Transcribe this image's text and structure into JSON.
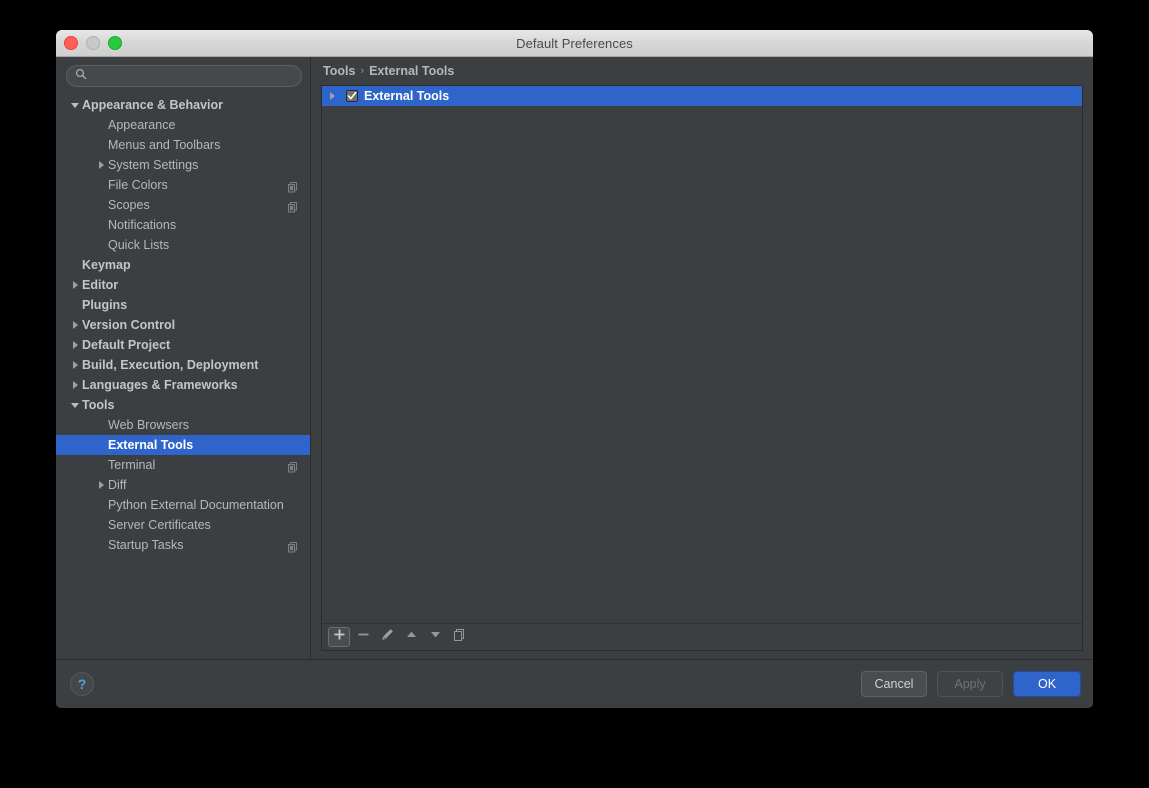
{
  "window": {
    "title": "Default Preferences",
    "traffic_lights": [
      "close-light",
      "minimize-light",
      "maximize-light"
    ]
  },
  "sidebar": {
    "search": {
      "value": "",
      "placeholder": "",
      "icon": "search-icon"
    },
    "items": [
      {
        "label": "Appearance & Behavior",
        "indent": 0,
        "arrow": "down",
        "bold": true,
        "selected": false,
        "badge": false
      },
      {
        "label": "Appearance",
        "indent": 1,
        "arrow": "none",
        "bold": false,
        "selected": false,
        "badge": false
      },
      {
        "label": "Menus and Toolbars",
        "indent": 1,
        "arrow": "none",
        "bold": false,
        "selected": false,
        "badge": false
      },
      {
        "label": "System Settings",
        "indent": 1,
        "arrow": "right",
        "bold": false,
        "selected": false,
        "badge": false
      },
      {
        "label": "File Colors",
        "indent": 1,
        "arrow": "none",
        "bold": false,
        "selected": false,
        "badge": true
      },
      {
        "label": "Scopes",
        "indent": 1,
        "arrow": "none",
        "bold": false,
        "selected": false,
        "badge": true
      },
      {
        "label": "Notifications",
        "indent": 1,
        "arrow": "none",
        "bold": false,
        "selected": false,
        "badge": false
      },
      {
        "label": "Quick Lists",
        "indent": 1,
        "arrow": "none",
        "bold": false,
        "selected": false,
        "badge": false
      },
      {
        "label": "Keymap",
        "indent": 0,
        "arrow": "none",
        "bold": true,
        "selected": false,
        "badge": false
      },
      {
        "label": "Editor",
        "indent": 0,
        "arrow": "right",
        "bold": true,
        "selected": false,
        "badge": false
      },
      {
        "label": "Plugins",
        "indent": 0,
        "arrow": "none",
        "bold": true,
        "selected": false,
        "badge": false
      },
      {
        "label": "Version Control",
        "indent": 0,
        "arrow": "right",
        "bold": true,
        "selected": false,
        "badge": false
      },
      {
        "label": "Default Project",
        "indent": 0,
        "arrow": "right",
        "bold": true,
        "selected": false,
        "badge": false
      },
      {
        "label": "Build, Execution, Deployment",
        "indent": 0,
        "arrow": "right",
        "bold": true,
        "selected": false,
        "badge": false
      },
      {
        "label": "Languages & Frameworks",
        "indent": 0,
        "arrow": "right",
        "bold": true,
        "selected": false,
        "badge": false
      },
      {
        "label": "Tools",
        "indent": 0,
        "arrow": "down",
        "bold": true,
        "selected": false,
        "badge": false
      },
      {
        "label": "Web Browsers",
        "indent": 1,
        "arrow": "none",
        "bold": false,
        "selected": false,
        "badge": false
      },
      {
        "label": "External Tools",
        "indent": 1,
        "arrow": "none",
        "bold": false,
        "selected": true,
        "badge": false
      },
      {
        "label": "Terminal",
        "indent": 1,
        "arrow": "none",
        "bold": false,
        "selected": false,
        "badge": true
      },
      {
        "label": "Diff",
        "indent": 1,
        "arrow": "right",
        "bold": false,
        "selected": false,
        "badge": false
      },
      {
        "label": "Python External Documentation",
        "indent": 1,
        "arrow": "none",
        "bold": false,
        "selected": false,
        "badge": false
      },
      {
        "label": "Server Certificates",
        "indent": 1,
        "arrow": "none",
        "bold": false,
        "selected": false,
        "badge": false
      },
      {
        "label": "Startup Tasks",
        "indent": 1,
        "arrow": "none",
        "bold": false,
        "selected": false,
        "badge": true
      }
    ]
  },
  "content": {
    "breadcrumb": {
      "root": "Tools",
      "separator": "›",
      "leaf": "External Tools"
    },
    "tree": [
      {
        "label": "External Tools",
        "arrow": "right",
        "checked": true,
        "selected": true
      }
    ],
    "toolbar": [
      {
        "name": "add-button",
        "icon": "plus-icon",
        "active": true
      },
      {
        "name": "remove-button",
        "icon": "minus-icon",
        "active": false
      },
      {
        "name": "edit-button",
        "icon": "pencil-icon",
        "active": false
      },
      {
        "name": "move-up-button",
        "icon": "arrow-up-icon",
        "active": false
      },
      {
        "name": "move-down-button",
        "icon": "arrow-down-icon",
        "active": false
      },
      {
        "name": "copy-button",
        "icon": "copy-icon",
        "active": false
      }
    ]
  },
  "footer": {
    "help_label": "?",
    "cancel_label": "Cancel",
    "apply_label": "Apply",
    "apply_enabled": false,
    "ok_label": "OK"
  },
  "colors": {
    "window_bg": "#3c3f41",
    "selection_blue": "#2f65ca",
    "text": "#b5b8ba",
    "accent_link": "#5a9fd4",
    "border": "#2b2b2b"
  }
}
